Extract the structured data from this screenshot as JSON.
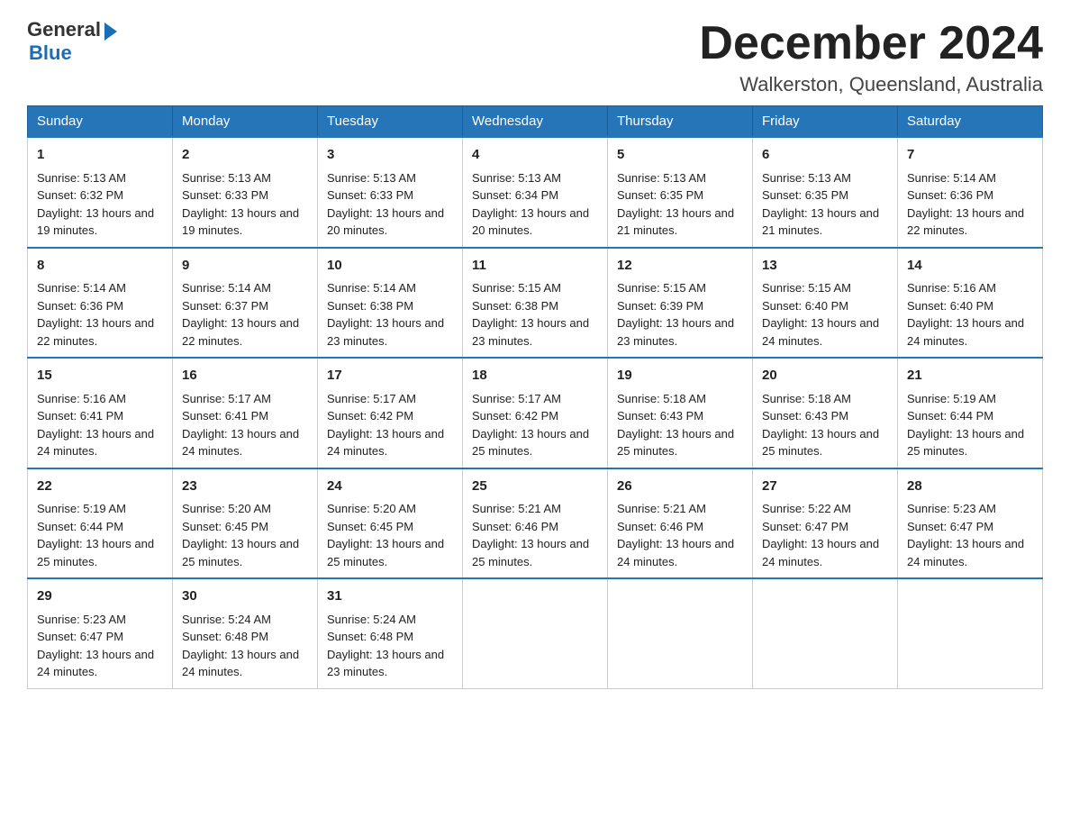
{
  "logo": {
    "general": "General",
    "blue": "Blue"
  },
  "title": "December 2024",
  "subtitle": "Walkerston, Queensland, Australia",
  "days_of_week": [
    "Sunday",
    "Monday",
    "Tuesday",
    "Wednesday",
    "Thursday",
    "Friday",
    "Saturday"
  ],
  "weeks": [
    [
      {
        "day": "1",
        "sunrise": "5:13 AM",
        "sunset": "6:32 PM",
        "daylight": "13 hours and 19 minutes."
      },
      {
        "day": "2",
        "sunrise": "5:13 AM",
        "sunset": "6:33 PM",
        "daylight": "13 hours and 19 minutes."
      },
      {
        "day": "3",
        "sunrise": "5:13 AM",
        "sunset": "6:33 PM",
        "daylight": "13 hours and 20 minutes."
      },
      {
        "day": "4",
        "sunrise": "5:13 AM",
        "sunset": "6:34 PM",
        "daylight": "13 hours and 20 minutes."
      },
      {
        "day": "5",
        "sunrise": "5:13 AM",
        "sunset": "6:35 PM",
        "daylight": "13 hours and 21 minutes."
      },
      {
        "day": "6",
        "sunrise": "5:13 AM",
        "sunset": "6:35 PM",
        "daylight": "13 hours and 21 minutes."
      },
      {
        "day": "7",
        "sunrise": "5:14 AM",
        "sunset": "6:36 PM",
        "daylight": "13 hours and 22 minutes."
      }
    ],
    [
      {
        "day": "8",
        "sunrise": "5:14 AM",
        "sunset": "6:36 PM",
        "daylight": "13 hours and 22 minutes."
      },
      {
        "day": "9",
        "sunrise": "5:14 AM",
        "sunset": "6:37 PM",
        "daylight": "13 hours and 22 minutes."
      },
      {
        "day": "10",
        "sunrise": "5:14 AM",
        "sunset": "6:38 PM",
        "daylight": "13 hours and 23 minutes."
      },
      {
        "day": "11",
        "sunrise": "5:15 AM",
        "sunset": "6:38 PM",
        "daylight": "13 hours and 23 minutes."
      },
      {
        "day": "12",
        "sunrise": "5:15 AM",
        "sunset": "6:39 PM",
        "daylight": "13 hours and 23 minutes."
      },
      {
        "day": "13",
        "sunrise": "5:15 AM",
        "sunset": "6:40 PM",
        "daylight": "13 hours and 24 minutes."
      },
      {
        "day": "14",
        "sunrise": "5:16 AM",
        "sunset": "6:40 PM",
        "daylight": "13 hours and 24 minutes."
      }
    ],
    [
      {
        "day": "15",
        "sunrise": "5:16 AM",
        "sunset": "6:41 PM",
        "daylight": "13 hours and 24 minutes."
      },
      {
        "day": "16",
        "sunrise": "5:17 AM",
        "sunset": "6:41 PM",
        "daylight": "13 hours and 24 minutes."
      },
      {
        "day": "17",
        "sunrise": "5:17 AM",
        "sunset": "6:42 PM",
        "daylight": "13 hours and 24 minutes."
      },
      {
        "day": "18",
        "sunrise": "5:17 AM",
        "sunset": "6:42 PM",
        "daylight": "13 hours and 25 minutes."
      },
      {
        "day": "19",
        "sunrise": "5:18 AM",
        "sunset": "6:43 PM",
        "daylight": "13 hours and 25 minutes."
      },
      {
        "day": "20",
        "sunrise": "5:18 AM",
        "sunset": "6:43 PM",
        "daylight": "13 hours and 25 minutes."
      },
      {
        "day": "21",
        "sunrise": "5:19 AM",
        "sunset": "6:44 PM",
        "daylight": "13 hours and 25 minutes."
      }
    ],
    [
      {
        "day": "22",
        "sunrise": "5:19 AM",
        "sunset": "6:44 PM",
        "daylight": "13 hours and 25 minutes."
      },
      {
        "day": "23",
        "sunrise": "5:20 AM",
        "sunset": "6:45 PM",
        "daylight": "13 hours and 25 minutes."
      },
      {
        "day": "24",
        "sunrise": "5:20 AM",
        "sunset": "6:45 PM",
        "daylight": "13 hours and 25 minutes."
      },
      {
        "day": "25",
        "sunrise": "5:21 AM",
        "sunset": "6:46 PM",
        "daylight": "13 hours and 25 minutes."
      },
      {
        "day": "26",
        "sunrise": "5:21 AM",
        "sunset": "6:46 PM",
        "daylight": "13 hours and 24 minutes."
      },
      {
        "day": "27",
        "sunrise": "5:22 AM",
        "sunset": "6:47 PM",
        "daylight": "13 hours and 24 minutes."
      },
      {
        "day": "28",
        "sunrise": "5:23 AM",
        "sunset": "6:47 PM",
        "daylight": "13 hours and 24 minutes."
      }
    ],
    [
      {
        "day": "29",
        "sunrise": "5:23 AM",
        "sunset": "6:47 PM",
        "daylight": "13 hours and 24 minutes."
      },
      {
        "day": "30",
        "sunrise": "5:24 AM",
        "sunset": "6:48 PM",
        "daylight": "13 hours and 24 minutes."
      },
      {
        "day": "31",
        "sunrise": "5:24 AM",
        "sunset": "6:48 PM",
        "daylight": "13 hours and 23 minutes."
      },
      null,
      null,
      null,
      null
    ]
  ],
  "labels": {
    "sunrise_prefix": "Sunrise: ",
    "sunset_prefix": "Sunset: ",
    "daylight_prefix": "Daylight: "
  }
}
